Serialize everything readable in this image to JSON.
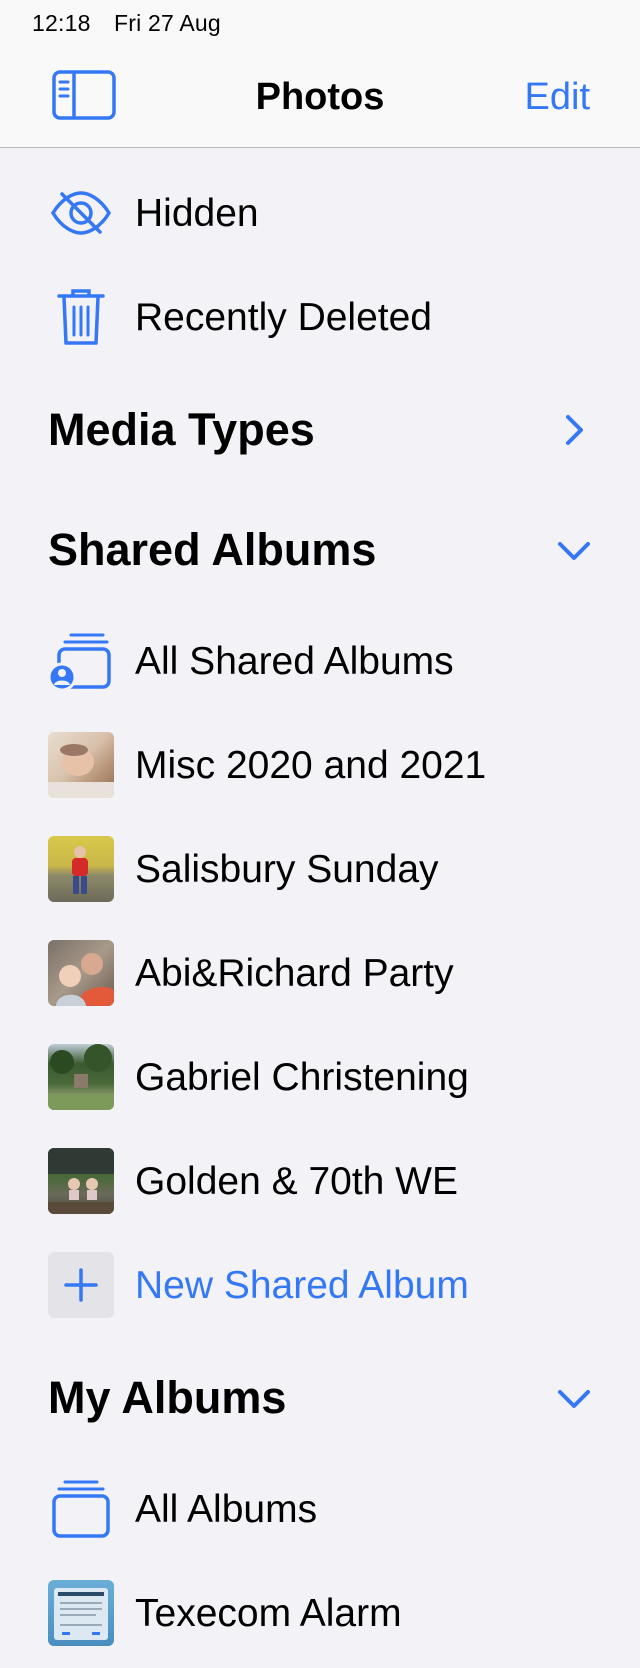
{
  "status": {
    "time": "12:18",
    "date": "Fri 27 Aug"
  },
  "nav": {
    "title": "Photos",
    "edit_label": "Edit"
  },
  "utilities": [
    {
      "label": "Hidden",
      "icon": "eye-slash-icon"
    },
    {
      "label": "Recently Deleted",
      "icon": "trash-icon"
    }
  ],
  "sections": {
    "media_types": {
      "title": "Media Types",
      "state": "collapsed"
    },
    "shared_albums": {
      "title": "Shared Albums",
      "state": "expanded",
      "items": [
        {
          "label": "All Shared Albums",
          "icon": "shared-albums-icon"
        },
        {
          "label": "Misc 2020 and 2021",
          "icon": "album-thumbnail"
        },
        {
          "label": "Salisbury Sunday",
          "icon": "album-thumbnail"
        },
        {
          "label": "Abi&Richard Party",
          "icon": "album-thumbnail"
        },
        {
          "label": "Gabriel Christening",
          "icon": "album-thumbnail"
        },
        {
          "label": "Golden & 70th WE",
          "icon": "album-thumbnail"
        }
      ],
      "new_label": "New Shared Album"
    },
    "my_albums": {
      "title": "My Albums",
      "state": "expanded",
      "items": [
        {
          "label": "All Albums",
          "icon": "albums-stack-icon"
        },
        {
          "label": "Texecom Alarm",
          "icon": "album-thumbnail"
        }
      ]
    }
  },
  "colors": {
    "accent": "#3478f6",
    "background": "#f2f2f7",
    "bar": "#f9f9f9"
  }
}
